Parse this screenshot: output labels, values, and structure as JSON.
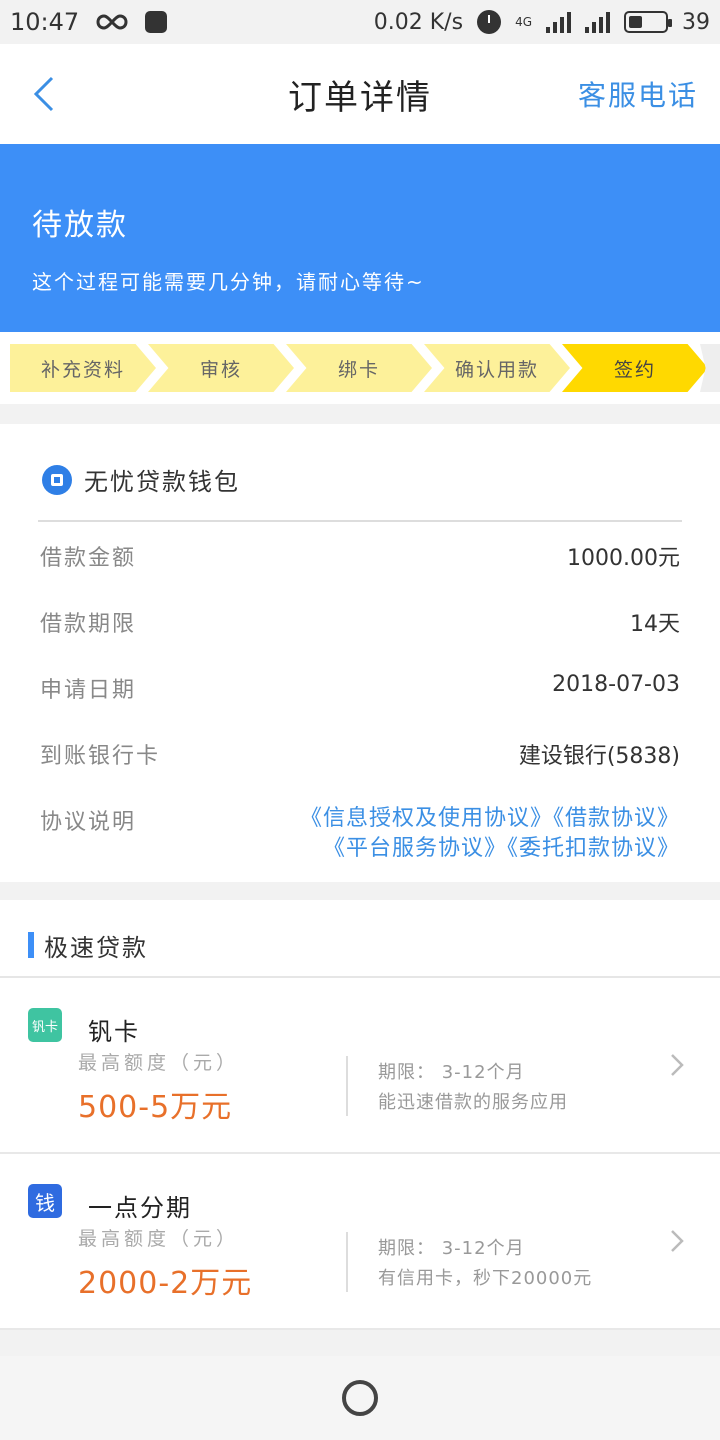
{
  "status_bar": {
    "time": "10:47",
    "net_speed": "0.02 K/s",
    "network": "4G",
    "battery": "39",
    "battery_level": 0.39,
    "icons": [
      "infinity-icon",
      "qq-icon",
      "alarm-icon",
      "signal-icon",
      "battery-icon"
    ]
  },
  "nav": {
    "title": "订单详情",
    "action": "客服电话"
  },
  "banner": {
    "title": "待放款",
    "subtitle": "这个过程可能需要几分钟，请耐心等待~"
  },
  "steps": [
    {
      "label": "补充资料",
      "active": false
    },
    {
      "label": "审核",
      "active": false
    },
    {
      "label": "绑卡",
      "active": false
    },
    {
      "label": "确认用款",
      "active": false
    },
    {
      "label": "签约",
      "active": true
    }
  ],
  "order": {
    "product": "无忧贷款钱包",
    "rows": [
      {
        "label": "借款金额",
        "value": "1000.00元"
      },
      {
        "label": "借款期限",
        "value": "14天"
      },
      {
        "label": "申请日期",
        "value": "2018-07-03"
      },
      {
        "label": "到账银行卡",
        "value": "建设银行(5838)"
      }
    ],
    "agreement_label": "协议说明",
    "agreements": [
      "《信息授权及使用协议》",
      "《借款协议》",
      "《平台服务协议》",
      "《委托扣款协议》"
    ]
  },
  "section": {
    "title": "极速贷款"
  },
  "loans": [
    {
      "icon_text": "钒卡",
      "name": "钒卡",
      "limit_label": "最高额度（元）",
      "amount": "500-5万元",
      "term": "期限： 3-12个月",
      "desc": "能迅速借款的服务应用"
    },
    {
      "icon_text": "钱",
      "name": "一点分期",
      "limit_label": "最高额度（元）",
      "amount": "2000-2万元",
      "term": "期限： 3-12个月",
      "desc": "有信用卡，秒下20000元"
    }
  ],
  "colors": {
    "brand_blue": "#3d8ff7",
    "link_blue": "#3b8fe4",
    "step_yellow": "#fdf19a",
    "step_active": "#ffd900",
    "amount_orange": "#e8702a"
  }
}
